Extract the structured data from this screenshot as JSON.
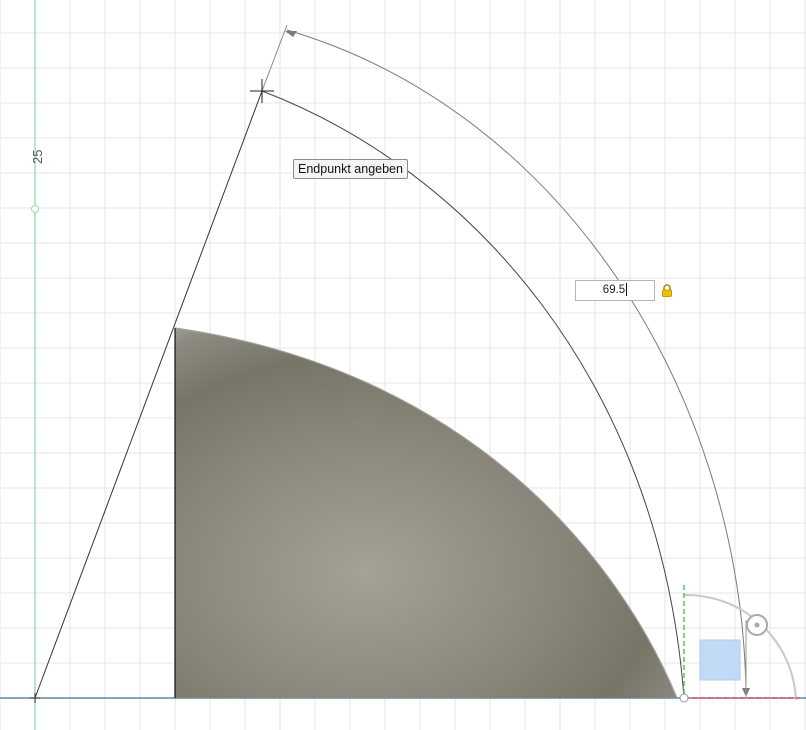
{
  "tooltip": {
    "text": "Endpunkt angeben"
  },
  "dimension": {
    "value": "69.5",
    "locked": true
  },
  "axis": {
    "vertical_label": "25"
  },
  "colors": {
    "grid": "#e3e3e3",
    "y_axis": "#7fd6a0",
    "x_axis": "#3d6f8c",
    "sketch_line": "#333333",
    "dimension_line": "#777777",
    "profile_fill": "#8e8b80",
    "triad_green": "#4cc44c",
    "triad_red": "#e04848",
    "view_cube": "#a7c8f0",
    "lock": "#e6b800"
  },
  "icons": [
    "lock-icon",
    "cursor-crosshair-icon",
    "orbit-handle-icon"
  ]
}
